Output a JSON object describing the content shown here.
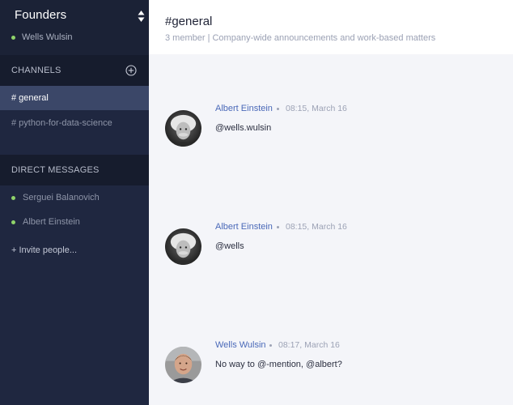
{
  "team": {
    "name": "Founders",
    "current_user": "Wells Wulsin"
  },
  "channels": {
    "heading": "CHANNELS",
    "items": [
      {
        "label": "# general",
        "active": true
      },
      {
        "label": "# python-for-data-science",
        "active": false
      }
    ]
  },
  "direct_messages": {
    "heading": "DIRECT MESSAGES",
    "items": [
      {
        "label": "Serguei Balanovich"
      },
      {
        "label": "Albert Einstein"
      }
    ],
    "invite_label": "+ Invite people..."
  },
  "header": {
    "title": "#general",
    "description": "3 member | Company-wide announcements and work-based matters"
  },
  "messages": [
    {
      "author": "Albert Einstein",
      "time": "08:15, March 16",
      "text": "@wells.wulsin"
    },
    {
      "author": "Albert Einstein",
      "time": "08:15, March 16",
      "text": "@wells"
    },
    {
      "author": "Wells Wulsin",
      "time": "08:17, March 16",
      "text": "No way to @-mention, @albert?"
    }
  ],
  "colors": {
    "sidebar_bg": "#1b2236",
    "active_channel": "#3b4768",
    "online": "#8fd36a",
    "author_link": "#4a69b8"
  }
}
